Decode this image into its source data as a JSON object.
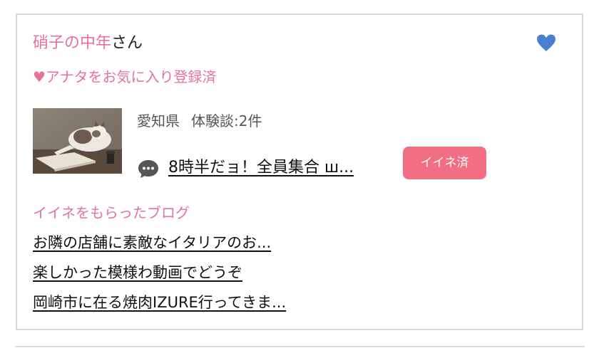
{
  "user": {
    "name": "硝子の中年",
    "suffix": "さん"
  },
  "favorite_status": "♥アナタをお気に入り登録済",
  "profile": {
    "prefecture": "愛知県",
    "experience_count": "体験談:2件"
  },
  "latest_post": {
    "title": "8時半だョ！全員集合 ш..."
  },
  "like_badge": "イイネ済",
  "liked_blogs": {
    "heading": "イイネをもらったブログ",
    "items": [
      "お隣の店舗に素敵なイタリアのお...",
      "楽しかった模様わ動画でどうぞ",
      "岡崎市に在る焼肉IZURE行ってきま..."
    ]
  },
  "colors": {
    "pink_text": "#e5739a",
    "badge": "#f26e83",
    "heart": "#4a7fd0",
    "comment_icon": "#555555",
    "border": "#d9d9d9"
  },
  "icons": {
    "heart": "heart-icon",
    "comment": "speech-bubble-icon"
  }
}
